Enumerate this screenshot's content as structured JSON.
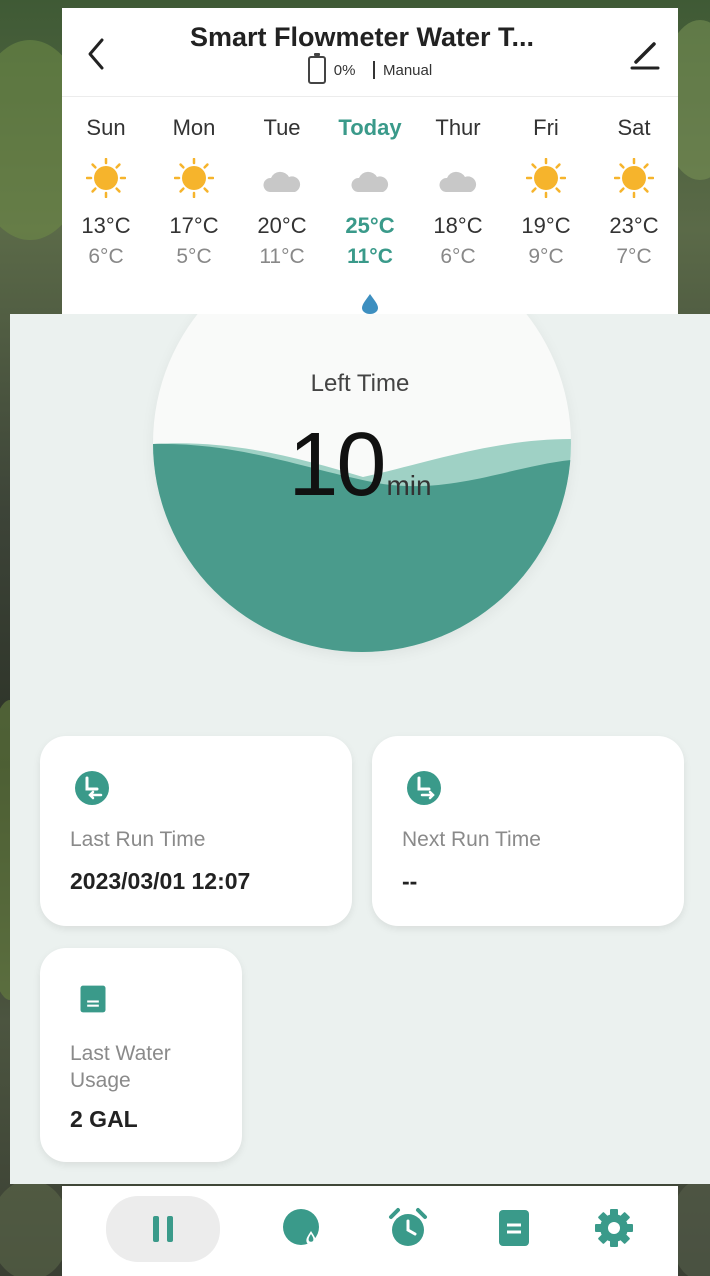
{
  "header": {
    "title": "Smart Flowmeter Water T...",
    "battery_percent": "0%",
    "mode": "Manual"
  },
  "weather": [
    {
      "day": "Sun",
      "icon": "sun-icon",
      "high": "13°C",
      "low": "6°C"
    },
    {
      "day": "Mon",
      "icon": "sun-icon",
      "high": "17°C",
      "low": "5°C"
    },
    {
      "day": "Tue",
      "icon": "cloud-icon",
      "high": "20°C",
      "low": "11°C"
    },
    {
      "day": "Today",
      "icon": "cloud-icon",
      "high": "25°C",
      "low": "11°C"
    },
    {
      "day": "Thur",
      "icon": "cloud-icon",
      "high": "18°C",
      "low": "6°C"
    },
    {
      "day": "Fri",
      "icon": "sun-icon",
      "high": "19°C",
      "low": "9°C"
    },
    {
      "day": "Sat",
      "icon": "sun-icon",
      "high": "23°C",
      "low": "7°C"
    }
  ],
  "timer": {
    "label": "Left Time",
    "value": "10",
    "unit": "min"
  },
  "cards": {
    "last_run": {
      "label": "Last Run Time",
      "value": "2023/03/01 12:07"
    },
    "next_run": {
      "label": "Next Run Time",
      "value": "--"
    },
    "last_water": {
      "label": "Last Water Usage",
      "value": "2 GAL"
    }
  },
  "colors": {
    "accent": "#3a9a8a",
    "water": "#4a9b8c",
    "sun": "#f6b42c",
    "cloud": "#c8c8c8"
  },
  "tabbar": {
    "items": [
      "pause-icon",
      "water-usage-icon",
      "alarm-clock-icon",
      "records-icon",
      "settings-icon"
    ],
    "active_index": 0
  }
}
